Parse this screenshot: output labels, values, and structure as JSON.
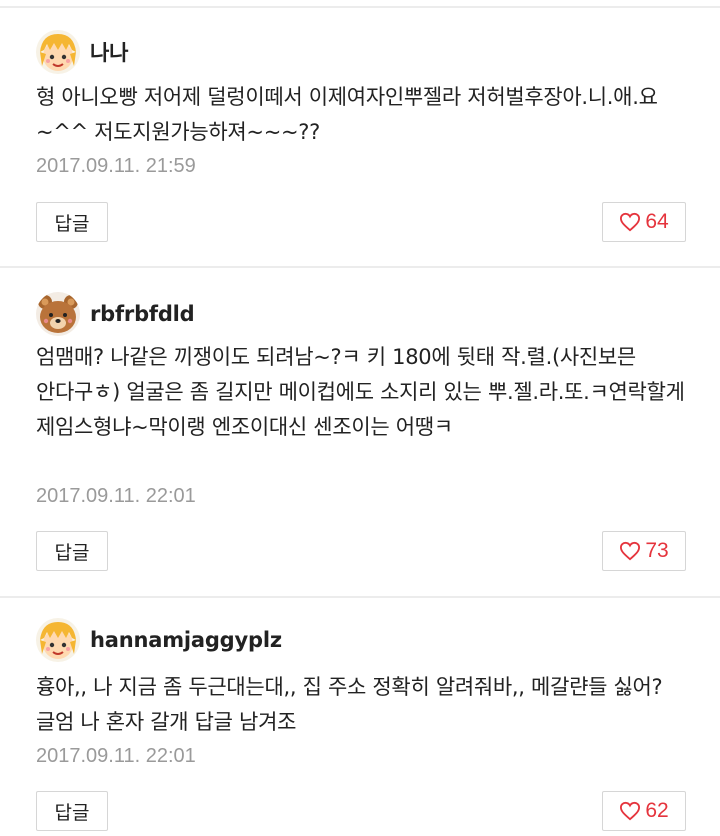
{
  "comments": [
    {
      "avatar": "blond-child-avatar-icon",
      "username": "나나",
      "text": "형 아니오빵 저어제 덜렁이떼서 이제여자인뿌젤라 저허벌후장아.니.애.요~^^ 저도지원가능하져~~~??",
      "timestamp": "2017.09.11. 21:59",
      "reply_label": "답글",
      "likes": "64"
    },
    {
      "avatar": "bear-avatar-icon",
      "username": "rbfrbfdld",
      "text": "엄맴매? 나같은 끼쟁이도 되려남~?ㅋ 키 180에 뒷태 작.렬.(사진보믄 안다구ㅎ) 얼굴은 좀 길지만 메이컵에도 소지리 있는 뿌.젤.라.또.ㅋ연락할게 제임스형냐~막이랭 엔조이대신 센조이는 어땡ㅋ",
      "timestamp": "2017.09.11. 22:01",
      "reply_label": "답글",
      "likes": "73"
    },
    {
      "avatar": "blond-child-avatar-icon",
      "username": "hannamjaggyplz",
      "text": "흉아,, 나 지금 좀 두근대는대,, 집 주소 정확히 알려줘바,, 메갈랸들 싫어? 글엄 나 혼자 갈개 답글 남겨조",
      "timestamp": "2017.09.11. 22:01",
      "reply_label": "답글",
      "likes": "62"
    }
  ],
  "colors": {
    "like_red": "#e5343d",
    "timestamp_gray": "#9a9a9a",
    "divider": "#ececec",
    "border": "#d6d6d6"
  }
}
